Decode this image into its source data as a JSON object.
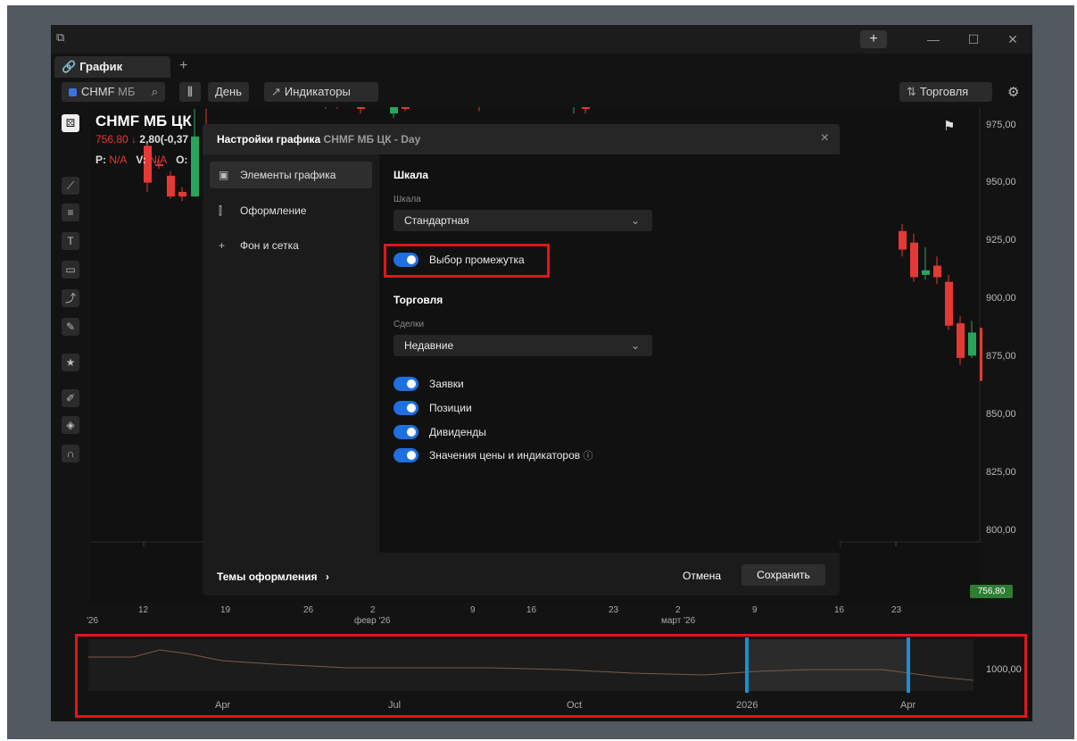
{
  "app": {
    "tab_label": "График",
    "add_tab": "+",
    "plus_button": "+",
    "minimize": "—",
    "maximize": "☐",
    "close": "✕"
  },
  "toolbar": {
    "ticker": "CHMF",
    "ticker_market": "МБ",
    "period": "День",
    "indicators": "Индикаторы",
    "trading": "Торговля"
  },
  "symbol": {
    "title": "CHMF МБ ЦК",
    "price": "756,80",
    "change": "2,80(-0,37",
    "ohlc_p_label": "P:",
    "ohlc_p_value": "N/A",
    "ohlc_v_label": "V:",
    "ohlc_v_value": "N/A",
    "ohlc_o_label": "O:"
  },
  "price_axis": [
    "975,00",
    "950,00",
    "925,00",
    "900,00",
    "875,00",
    "850,00",
    "825,00",
    "800,00"
  ],
  "last_price": "756,80",
  "date_axis": [
    {
      "label": "'26"
    },
    {
      "label": "12"
    },
    {
      "label": "19"
    },
    {
      "label": "26"
    },
    {
      "label": "2"
    },
    {
      "label": "9"
    },
    {
      "label": "16"
    },
    {
      "label": "23"
    },
    {
      "label": "2"
    },
    {
      "label": "9"
    },
    {
      "label": "16"
    },
    {
      "label": "23"
    }
  ],
  "month_axis": [
    "февр '26",
    "март '26"
  ],
  "navigator": {
    "labels": [
      "Apr",
      "Jul",
      "Oct",
      "2026",
      "Apr"
    ],
    "price": "1000,00"
  },
  "dialog": {
    "title": "Настройки графика",
    "title_symbol": "CHMF МБ ЦК - Day",
    "close": "×",
    "sidebar": [
      {
        "label": "Элементы графика",
        "icon": "chart-elements-icon"
      },
      {
        "label": "Оформление",
        "icon": "style-icon"
      },
      {
        "label": "Фон и сетка",
        "icon": "grid-icon"
      }
    ],
    "scale_section": "Шкала",
    "scale_field_label": "Шкала",
    "scale_value": "Стандартная",
    "range_toggle": "Выбор промежутка",
    "trading_section": "Торговля",
    "deals_label": "Сделки",
    "deals_value": "Недавние",
    "toggles": [
      "Заявки",
      "Позиции",
      "Дивиденды",
      "Значения цены и индикаторов"
    ],
    "info_icon": "ⓘ",
    "themes": "Темы оформления",
    "cancel": "Отмена",
    "save": "Сохранить"
  },
  "colors": {
    "up": "#26a65b",
    "down": "#e53935",
    "accent": "#1e6fe0",
    "highlight": "#e0161b"
  }
}
